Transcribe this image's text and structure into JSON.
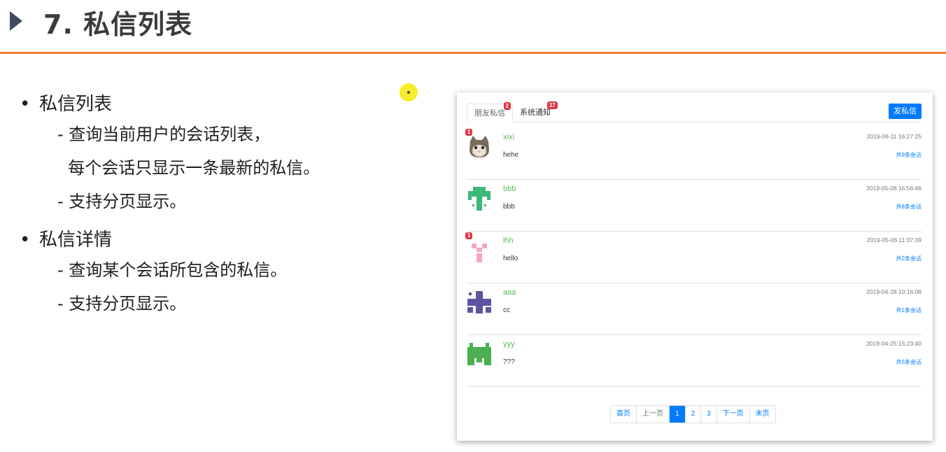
{
  "slide": {
    "title": "7. 私信列表"
  },
  "bullets": [
    {
      "label": "私信列表",
      "items": [
        "- 查询当前用户的会话列表，",
        "  每个会话只显示一条最新的私信。",
        "- 支持分页显示。"
      ]
    },
    {
      "label": "私信详情",
      "items": [
        "- 查询某个会话所包含的私信。",
        "- 支持分页显示。"
      ]
    }
  ],
  "panel": {
    "tabs": [
      {
        "label": "朋友私信",
        "badge": "2",
        "active": true
      },
      {
        "label": "系统通知",
        "badge": "27",
        "active": false
      }
    ],
    "send_button": "发私信",
    "conversations": [
      {
        "unread": "1",
        "username": "xixi",
        "message": "hehe",
        "time": "2019-06-11 16:27:25",
        "count": "共9条会话",
        "avatar": "cat-avatar-icon",
        "color": "#7a6a5c"
      },
      {
        "unread": "",
        "username": "bbb",
        "message": "bbb",
        "time": "2019-05-08 16:56:46",
        "count": "共8条会话",
        "avatar": "identicon-avatar-icon",
        "color": "#3cb878"
      },
      {
        "unread": "1",
        "username": "lhh",
        "message": "hello",
        "time": "2019-05-06 11:37:39",
        "count": "共2条会话",
        "avatar": "identicon-avatar-icon",
        "color": "#f6a6c8"
      },
      {
        "unread": "",
        "username": "aaa",
        "message": "cc",
        "time": "2019-04-28 10:16:08",
        "count": "共1条会话",
        "avatar": "identicon-avatar-icon",
        "color": "#5a55a0"
      },
      {
        "unread": "",
        "username": "yyy",
        "message": "???",
        "time": "2019-04-25 15:23:40",
        "count": "共5条会话",
        "avatar": "identicon-avatar-icon",
        "color": "#4caf50"
      }
    ],
    "pagination": {
      "first": "首页",
      "prev": "上一页",
      "pages": [
        "1",
        "2",
        "3"
      ],
      "current": "1",
      "next": "下一页",
      "last": "末页"
    }
  }
}
